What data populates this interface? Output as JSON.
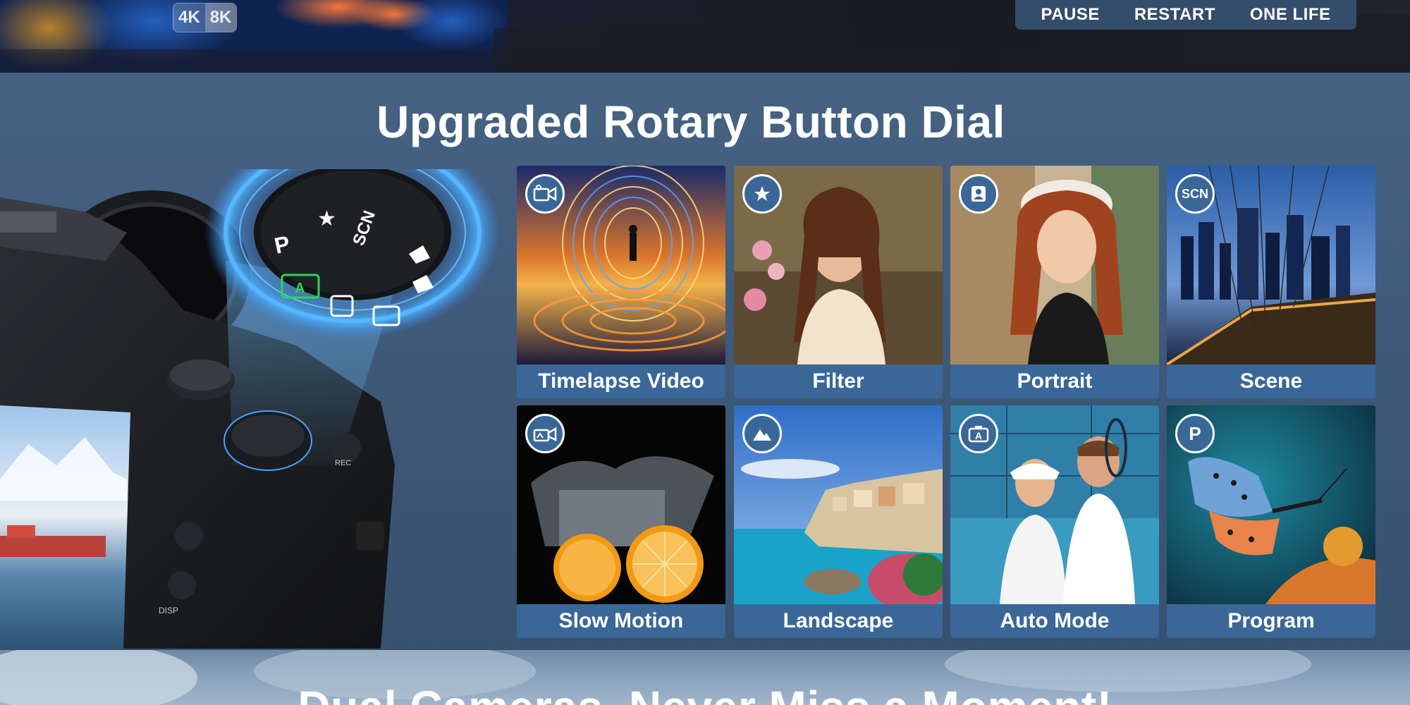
{
  "top_banner": {
    "resolution_badges": [
      "4K",
      "8K"
    ],
    "menu": [
      "PAUSE",
      "RESTART",
      "ONE LIFE"
    ]
  },
  "heading": "Upgraded Rotary Button Dial",
  "dial": {
    "labels": [
      "P",
      "SCN"
    ]
  },
  "tiles": [
    {
      "label": "Timelapse Video",
      "icon": "video-camera-icon"
    },
    {
      "label": "Filter",
      "icon": "star-icon"
    },
    {
      "label": "Portrait",
      "icon": "person-icon"
    },
    {
      "label": "Scene",
      "icon": "scn-icon",
      "icon_text": "SCN"
    },
    {
      "label": "Slow Motion",
      "icon": "slow-motion-camera-icon"
    },
    {
      "label": "Landscape",
      "icon": "mountain-icon"
    },
    {
      "label": "Auto Mode",
      "icon": "auto-camera-icon"
    },
    {
      "label": "Program",
      "icon": "p-icon",
      "icon_text": "P"
    }
  ],
  "camera_labels": [
    "REC",
    "DISP"
  ],
  "bottom_heading": "Dual Cameras, Never Miss a Moment!",
  "colors": {
    "caption_bg": "#3a6797",
    "background": "#445f80",
    "menu_bg": "#344d6b"
  }
}
